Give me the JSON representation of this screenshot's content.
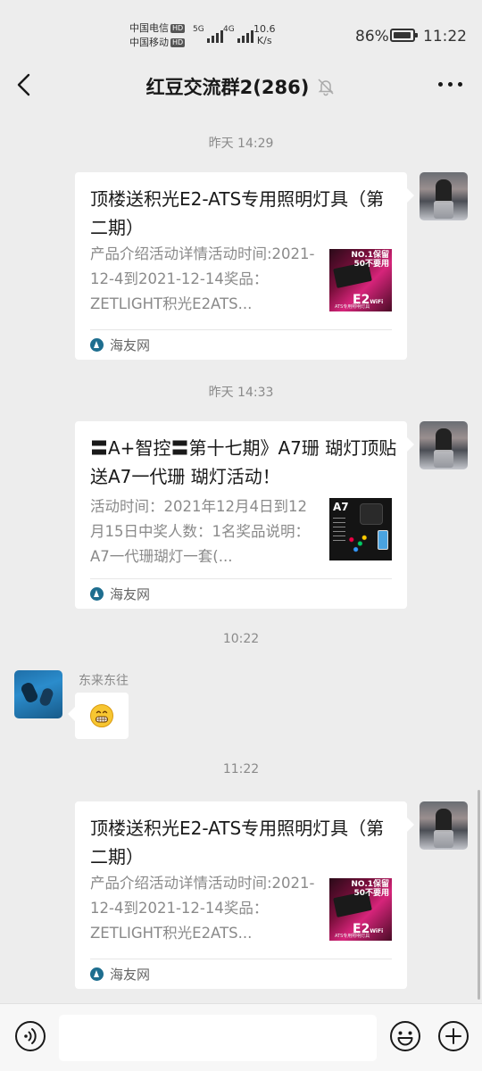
{
  "status_bar": {
    "carrier1": "中国电信",
    "carrier2": "中国移动",
    "hd_badge": "HD",
    "net1": "5G",
    "net2": "4G",
    "speed_value": "10.6",
    "speed_unit": "K/s",
    "battery_pct": "86%",
    "battery_level": 0.86,
    "time": "11:22"
  },
  "header": {
    "title": "红豆交流群2(286)",
    "back_icon": "chevron-left-icon",
    "mute_icon": "bell-off-icon",
    "more_icon": "more-horizontal-icon"
  },
  "messages": [
    {
      "timestamp": "昨天 14:29",
      "card": {
        "title": "顶楼送积光E2-ATS专用照明灯具（第二期）",
        "description": "产品介绍活动详情活动时间:2021-12-4到2021-12-14奖品：ZETLIGHT积光E2ATS...",
        "source": "海友网",
        "thumb": {
          "tag": "NO.1保留\n50不要用",
          "big": "E2",
          "big_sup": "WiFi",
          "sub": "ATS专用照明灯具"
        }
      }
    },
    {
      "timestamp": "昨天 14:33",
      "card": {
        "title": "〓A+智控〓第十七期》A7珊 瑚灯顶贴送A7一代珊 瑚灯活动！",
        "description": "活动时间：2021年12月4日到12月15日中奖人数：1名奖品说明：A7一代珊瑚灯一套(...",
        "source": "海友网",
        "thumb": {
          "label": "A7"
        }
      }
    },
    {
      "timestamp": "10:22",
      "sender": "东来东往",
      "emoji": "grinning-teeth-emoji"
    },
    {
      "timestamp": "11:22",
      "card": {
        "title": "顶楼送积光E2-ATS专用照明灯具（第二期）",
        "description": "产品介绍活动详情活动时间:2021-12-4到2021-12-14奖品：ZETLIGHT积光E2ATS...",
        "source": "海友网",
        "thumb": {
          "tag": "NO.1保留\n50不要用",
          "big": "E2",
          "big_sup": "WiFi",
          "sub": "ATS专用照明灯具"
        }
      }
    }
  ],
  "input_bar": {
    "voice_icon": "voice-icon",
    "emoji_icon": "smiley-icon",
    "plus_icon": "plus-circle-icon"
  }
}
